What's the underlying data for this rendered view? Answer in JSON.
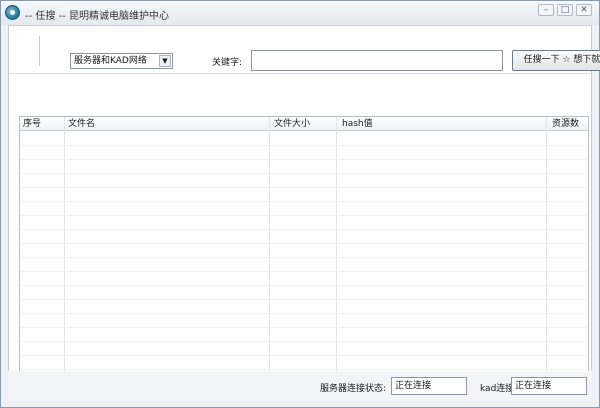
{
  "window": {
    "title": "-- 任搜 -- 昆明精诚电脑维护中心",
    "icons": {
      "app": "app-logo-icon",
      "minimize": "minimize-icon",
      "maximize": "maximize-icon",
      "close": "close-icon"
    },
    "minimize_glyph": "–",
    "maximize_glyph": "□",
    "close_glyph": "✕"
  },
  "toolbar": {
    "network_select": {
      "selected": "服务器和KAD网络",
      "arrow": "▼"
    },
    "keyword_label": "关键字:",
    "keyword_value": "",
    "search_button": "任搜一下 ☆ 想下就下"
  },
  "results_table": {
    "columns": [
      "序号",
      "文件名",
      "文件大小",
      "hash值",
      "资源数"
    ],
    "rows": []
  },
  "status": {
    "server_label": "服务器连接状态:",
    "server_value": "正在连接",
    "kad_label": "kad连接",
    "kad_value": "正在连接"
  }
}
